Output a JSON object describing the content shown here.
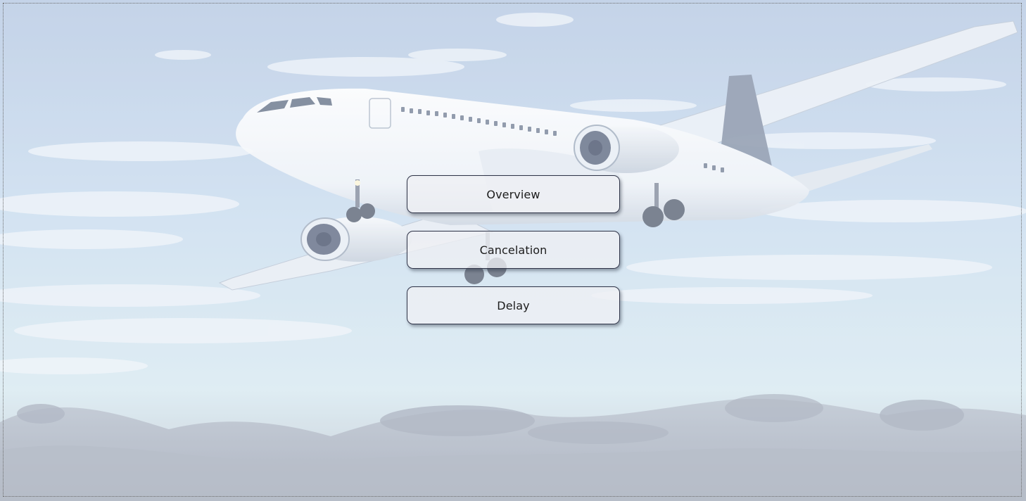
{
  "background": {
    "image": "airplane-in-sky-photo",
    "sky_top": "#b7c9e3",
    "sky_bottom": "#d8e7ef",
    "cloud_dark": "#9aa3b3"
  },
  "menu": {
    "buttons": [
      {
        "id": "overview",
        "label": "Overview"
      },
      {
        "id": "cancelation",
        "label": "Cancelation"
      },
      {
        "id": "delay",
        "label": "Delay"
      }
    ]
  }
}
